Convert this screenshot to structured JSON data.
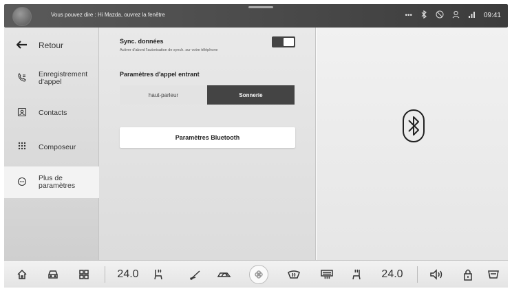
{
  "status_bar": {
    "voice_hint": "Vous pouvez dire : Hi Mazda, ouvrez la fenêtre",
    "time": "09:41",
    "icons": [
      "more-icon",
      "bluetooth-icon",
      "no-phone-icon",
      "user-icon",
      "signal-icon"
    ]
  },
  "sidebar": {
    "back_label": "Retour",
    "items": [
      {
        "label": "Enregistrement\nd'appel",
        "icon": "call-log-icon"
      },
      {
        "label": "Contacts",
        "icon": "contacts-icon"
      },
      {
        "label": "Composeur",
        "icon": "dialpad-icon"
      },
      {
        "label": "Plus de\nparamètres",
        "icon": "more-settings-icon",
        "active": true
      }
    ]
  },
  "settings": {
    "sync_title": "Sync. données",
    "sync_subtitle": "Activer d'abord l'autorisation de synch. sur votre téléphone",
    "sync_enabled": true,
    "incoming_title": "Paramètres d'appel entrant",
    "options": [
      "haut-parleur",
      "Sonnerie"
    ],
    "selected_option": "Sonnerie",
    "bluetooth_button": "Paramètres Bluetooth"
  },
  "bottom_bar": {
    "left_temp": "24.0",
    "right_temp": "24.0",
    "icons": [
      "home-icon",
      "car-icon",
      "apps-icon",
      "seat-heat-left-icon",
      "wiper-icon",
      "recirculation-icon",
      "fan-icon",
      "defrost-front-icon",
      "defrost-rear-icon",
      "seat-heat-right-icon",
      "volume-icon",
      "lock-icon",
      "rear-view-icon"
    ]
  },
  "colors": {
    "status_bar_bg": "#4a4a4a",
    "selected_segment": "#444444",
    "toggle_on": "#444444"
  }
}
